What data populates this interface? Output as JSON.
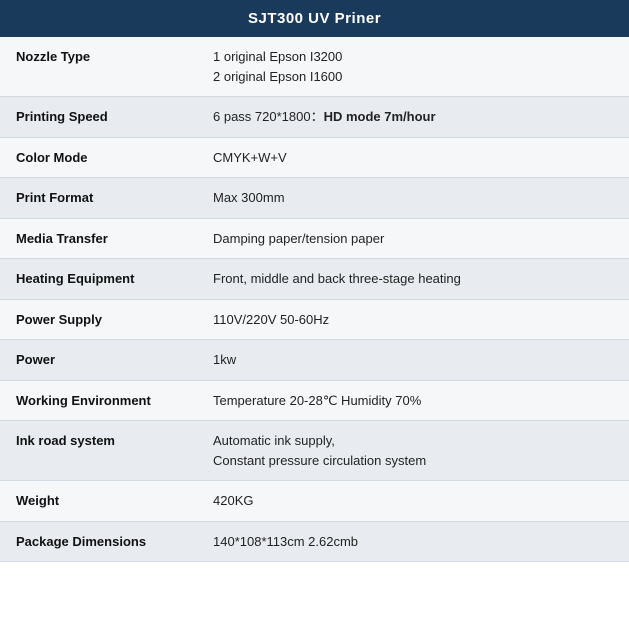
{
  "header": {
    "title": "SJT300 UV Priner",
    "bg_color": "#1a3a5c",
    "text_color": "#ffffff"
  },
  "rows": [
    {
      "label": "Nozzle Type",
      "value": "1 original Epson I3200\n2 original Epson I1600",
      "has_bold": false
    },
    {
      "label": "Printing Speed",
      "value_prefix": "6 pass 720*1800：",
      "value_bold": "HD mode 7m/hour",
      "has_bold": true
    },
    {
      "label": "Color Mode",
      "value": "CMYK+W+V",
      "has_bold": false
    },
    {
      "label": "Print Format",
      "value": "Max 300mm",
      "has_bold": false
    },
    {
      "label": "Media Transfer",
      "value": "Damping paper/tension paper",
      "has_bold": false
    },
    {
      "label": "Heating Equipment",
      "value": "Front, middle and back three-stage heating",
      "has_bold": false
    },
    {
      "label": "Power Supply",
      "value": "110V/220V 50-60Hz",
      "has_bold": false
    },
    {
      "label": "Power",
      "value": "1kw",
      "has_bold": false
    },
    {
      "label": "Working Environment",
      "value": "Temperature 20-28℃ Humidity 70%",
      "has_bold": false
    },
    {
      "label": "Ink road system",
      "value": "Automatic ink supply,\nConstant pressure circulation system",
      "has_bold": false
    },
    {
      "label": "Weight",
      "value": "420KG",
      "has_bold": false
    },
    {
      "label": "Package Dimensions",
      "value": "140*108*113cm 2.62cmb",
      "has_bold": false
    }
  ]
}
